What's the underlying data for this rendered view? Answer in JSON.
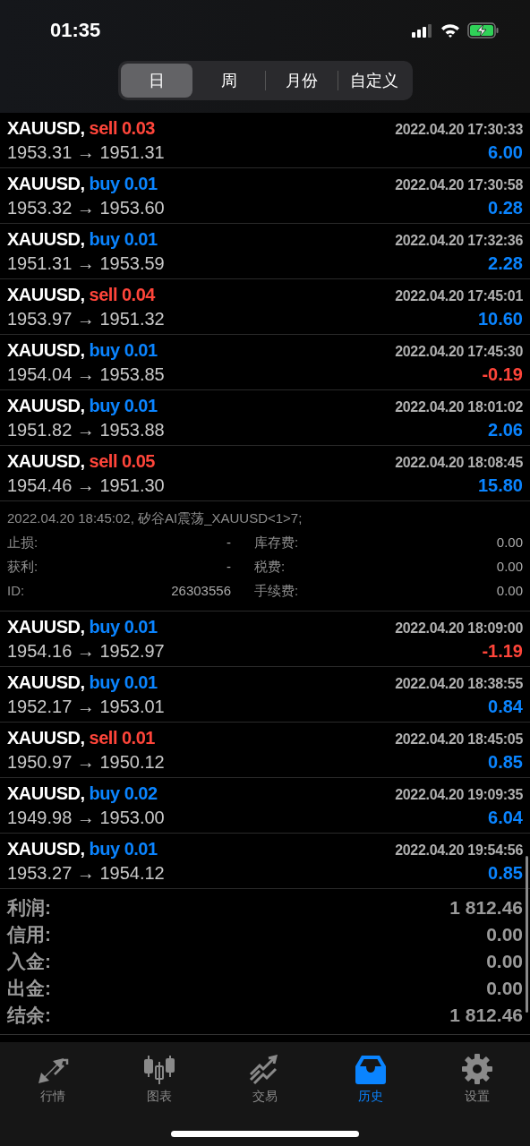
{
  "status_bar": {
    "time": "01:35"
  },
  "segments": [
    {
      "label": "日",
      "selected": true
    },
    {
      "label": "周",
      "selected": false
    },
    {
      "label": "月份",
      "selected": false
    },
    {
      "label": "自定义",
      "selected": false
    }
  ],
  "trades": [
    {
      "symbol": "XAUUSD,",
      "order": "sell 0.03",
      "kind": "sell",
      "time": "2022.04.20 17:30:33",
      "prices": "1953.31 → 1951.31",
      "profit": "6.00",
      "loss": false
    },
    {
      "symbol": "XAUUSD,",
      "order": "buy 0.01",
      "kind": "buy",
      "time": "2022.04.20 17:30:58",
      "prices": "1953.32 → 1953.60",
      "profit": "0.28",
      "loss": false
    },
    {
      "symbol": "XAUUSD,",
      "order": "buy 0.01",
      "kind": "buy",
      "time": "2022.04.20 17:32:36",
      "prices": "1951.31 → 1953.59",
      "profit": "2.28",
      "loss": false
    },
    {
      "symbol": "XAUUSD,",
      "order": "sell 0.04",
      "kind": "sell",
      "time": "2022.04.20 17:45:01",
      "prices": "1953.97 → 1951.32",
      "profit": "10.60",
      "loss": false
    },
    {
      "symbol": "XAUUSD,",
      "order": "buy 0.01",
      "kind": "buy",
      "time": "2022.04.20 17:45:30",
      "prices": "1954.04 → 1953.85",
      "profit": "-0.19",
      "loss": true
    },
    {
      "symbol": "XAUUSD,",
      "order": "buy 0.01",
      "kind": "buy",
      "time": "2022.04.20 18:01:02",
      "prices": "1951.82 → 1953.88",
      "profit": "2.06",
      "loss": false
    },
    {
      "symbol": "XAUUSD,",
      "order": "sell 0.05",
      "kind": "sell",
      "time": "2022.04.20 18:08:45",
      "prices": "1954.46 → 1951.30",
      "profit": "15.80",
      "loss": false,
      "details": {
        "comment": "2022.04.20 18:45:02, 矽谷AI震荡_XAUUSD<1>7;",
        "fields": [
          {
            "label": "止损:",
            "value": "-"
          },
          {
            "label": "库存费:",
            "value": "0.00"
          },
          {
            "label": "获利:",
            "value": "-"
          },
          {
            "label": "税费:",
            "value": "0.00"
          },
          {
            "label": "ID:",
            "value": "26303556"
          },
          {
            "label": "手续费:",
            "value": "0.00"
          }
        ]
      }
    },
    {
      "symbol": "XAUUSD,",
      "order": "buy 0.01",
      "kind": "buy",
      "time": "2022.04.20 18:09:00",
      "prices": "1954.16 → 1952.97",
      "profit": "-1.19",
      "loss": true
    },
    {
      "symbol": "XAUUSD,",
      "order": "buy 0.01",
      "kind": "buy",
      "time": "2022.04.20 18:38:55",
      "prices": "1952.17 → 1953.01",
      "profit": "0.84",
      "loss": false
    },
    {
      "symbol": "XAUUSD,",
      "order": "sell 0.01",
      "kind": "sell",
      "time": "2022.04.20 18:45:05",
      "prices": "1950.97 → 1950.12",
      "profit": "0.85",
      "loss": false
    },
    {
      "symbol": "XAUUSD,",
      "order": "buy 0.02",
      "kind": "buy",
      "time": "2022.04.20 19:09:35",
      "prices": "1949.98 → 1953.00",
      "profit": "6.04",
      "loss": false
    },
    {
      "symbol": "XAUUSD,",
      "order": "buy 0.01",
      "kind": "buy",
      "time": "2022.04.20 19:54:56",
      "prices": "1953.27 → 1954.12",
      "profit": "0.85",
      "loss": false
    }
  ],
  "summary": [
    {
      "label": "利润:",
      "value": "1 812.46"
    },
    {
      "label": "信用:",
      "value": "0.00"
    },
    {
      "label": "入金:",
      "value": "0.00"
    },
    {
      "label": "出金:",
      "value": "0.00"
    },
    {
      "label": "结余:",
      "value": "1 812.46"
    }
  ],
  "tab_bar": [
    {
      "label": "行情",
      "kind": "quotes",
      "selected": false
    },
    {
      "label": "图表",
      "kind": "chart",
      "selected": false
    },
    {
      "label": "交易",
      "kind": "trade",
      "selected": false
    },
    {
      "label": "历史",
      "kind": "history",
      "selected": true
    },
    {
      "label": "设置",
      "kind": "settings",
      "selected": false
    }
  ]
}
